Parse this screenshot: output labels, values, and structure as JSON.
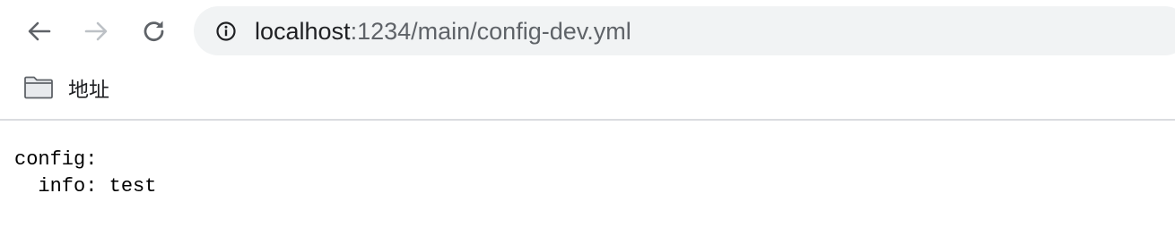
{
  "browser": {
    "nav": {
      "back_icon": "arrow-left",
      "forward_icon": "arrow-right",
      "reload_icon": "reload"
    },
    "address_bar": {
      "icon": "info-circle",
      "host": "localhost",
      "path": ":1234/main/config-dev.yml"
    },
    "bookmarks": [
      {
        "label": "地址",
        "icon": "folder"
      }
    ]
  },
  "page": {
    "lines": [
      "config:",
      "  info: test"
    ]
  },
  "colors": {
    "omnibox_bg": "#f1f3f4",
    "icon_active": "#5f6368",
    "icon_disabled": "#bdc1c6",
    "text": "#202124",
    "divider": "#dadce0"
  }
}
